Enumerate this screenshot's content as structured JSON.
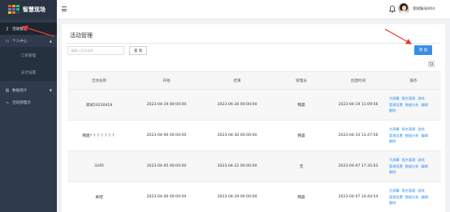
{
  "app": {
    "logo_text": "智慧现场",
    "logo_colors": [
      "#e84c3d",
      "#f39c12",
      "#2ecc71",
      "#3498db",
      "#9b59b6",
      "#1abc9c",
      "#f1c40f",
      "#e67e22",
      "#34495e"
    ]
  },
  "sidebar": {
    "items": [
      {
        "label": "活动管理",
        "icon": "document-icon",
        "active": true
      },
      {
        "label": "个人中心",
        "icon": "user-card-icon",
        "expanded": true
      },
      {
        "label": "数据统计",
        "icon": "chart-icon"
      },
      {
        "label": "活动管理示",
        "icon": "share-icon"
      }
    ],
    "sub_items": [
      {
        "label": "订单管理"
      },
      {
        "label": "支付设置"
      }
    ]
  },
  "header": {
    "hamburger_icon": "menu-icon",
    "bell_icon": "bell-icon",
    "username": "测试账号004"
  },
  "main": {
    "title": "活动管理",
    "search": {
      "placeholder": "请输入活动名称",
      "value": ""
    },
    "query_label": "查 询",
    "add_label": "添 加",
    "table": {
      "headers": [
        "活动名称",
        "开始",
        "结束",
        "管理员",
        "创建时间",
        "操作"
      ],
      "rows": [
        {
          "name": "测试20230419",
          "start": "2023-04-19 00:00:00",
          "end": "2023-06-30 00:00:00",
          "admin": "韩晨",
          "created": "2023-04-19 11:09:56"
        },
        {
          "name": "韩建？？？？？？？",
          "start": "2023-04-06 00:00:00",
          "end": "2023-04-30 00:00:00",
          "admin": "韩晨",
          "created": "2023-04-10 13:47:56"
        },
        {
          "name": "3245",
          "start": "2023-04-05 00:00:00",
          "end": "2023-04-22 00:00:00",
          "admin": "无",
          "created": "2023-04-07 17:35:03"
        },
        {
          "name": "来吧",
          "start": "2023-04-06 00:00:00",
          "end": "2023-04-29 00:00:00",
          "admin": "韩晨",
          "created": "2023-04-07 14:44:54"
        }
      ],
      "ops": {
        "line1": [
          "大屏幕",
          "报名管理",
          "游戏"
        ],
        "line2": [
          "管理设置",
          "数据分析",
          "编辑"
        ],
        "line3": [
          "删除"
        ]
      }
    }
  },
  "colors": {
    "sidebar_bg": "#2f3b4c",
    "accent": "#3a8ee6",
    "link": "#2d8cf0",
    "annotation": "#e53935"
  }
}
